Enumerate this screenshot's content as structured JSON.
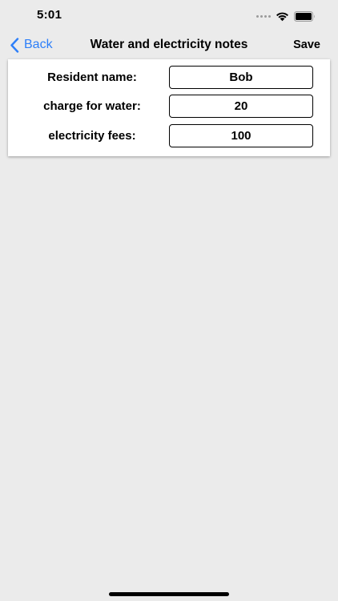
{
  "status_bar": {
    "time": "5:01"
  },
  "nav": {
    "back_label": "Back",
    "title": "Water and electricity notes",
    "save_label": "Save"
  },
  "form": {
    "rows": [
      {
        "label": "Resident name:",
        "value": "Bob"
      },
      {
        "label": "charge for water:",
        "value": "20"
      },
      {
        "label": "electricity fees:",
        "value": "100"
      }
    ]
  },
  "colors": {
    "accent": "#2d7ff9",
    "background": "#ebebeb",
    "card": "#ffffff"
  },
  "icons": {
    "back": "chevron-left-icon",
    "cellular": "cellular-signal-icon",
    "wifi": "wifi-icon",
    "battery": "battery-icon"
  }
}
